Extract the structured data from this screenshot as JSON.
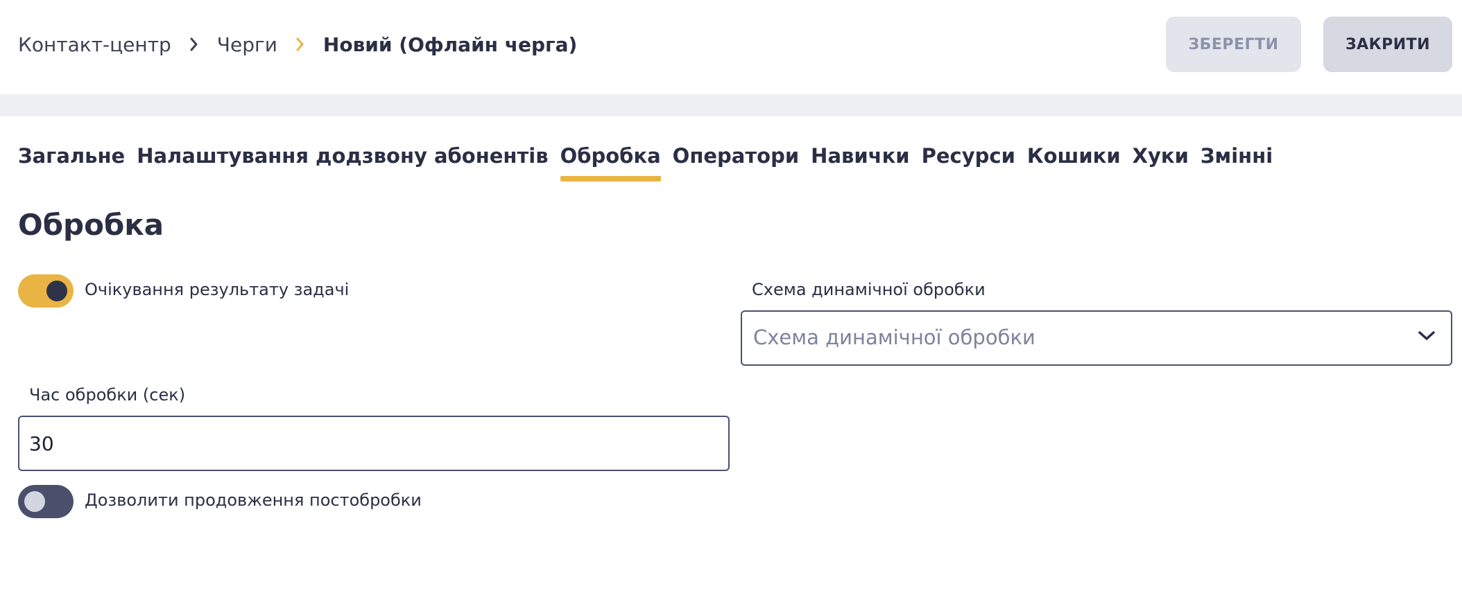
{
  "breadcrumb": {
    "items": [
      "Контакт-центр",
      "Черги"
    ],
    "current": "Новий (Офлайн черга)"
  },
  "toolbar": {
    "save_label": "ЗБЕРЕГТИ",
    "close_label": "ЗАКРИТИ"
  },
  "tabs": [
    {
      "label": "Загальне",
      "active": false
    },
    {
      "label": "Налаштування додзвону абонентів",
      "active": false
    },
    {
      "label": "Обробка",
      "active": true
    },
    {
      "label": "Оператори",
      "active": false
    },
    {
      "label": "Навички",
      "active": false
    },
    {
      "label": "Ресурси",
      "active": false
    },
    {
      "label": "Кошики",
      "active": false
    },
    {
      "label": "Хуки",
      "active": false
    },
    {
      "label": "Змінні",
      "active": false
    }
  ],
  "section": {
    "title": "Обробка",
    "wait_result_toggle": {
      "label": "Очікування результату задачі",
      "on": true
    },
    "dynamic_scheme": {
      "label": "Схема динамічної обробки",
      "placeholder": "Схема динамічної обробки",
      "value": ""
    },
    "processing_time": {
      "label": "Час обробки (сек)",
      "value": "30"
    },
    "allow_extension_toggle": {
      "label": "Дозволити продовження постобробки",
      "on": false
    }
  },
  "colors": {
    "accent": "#e9b443",
    "text": "#2a2f45",
    "toggle_off": "#4a4f6b",
    "button_save_bg": "#e3e5ec",
    "button_close_bg": "#d6d8e2"
  },
  "icons": {
    "breadcrumb_separator": "chevron-right-icon",
    "select_chevron": "chevron-down-icon"
  }
}
